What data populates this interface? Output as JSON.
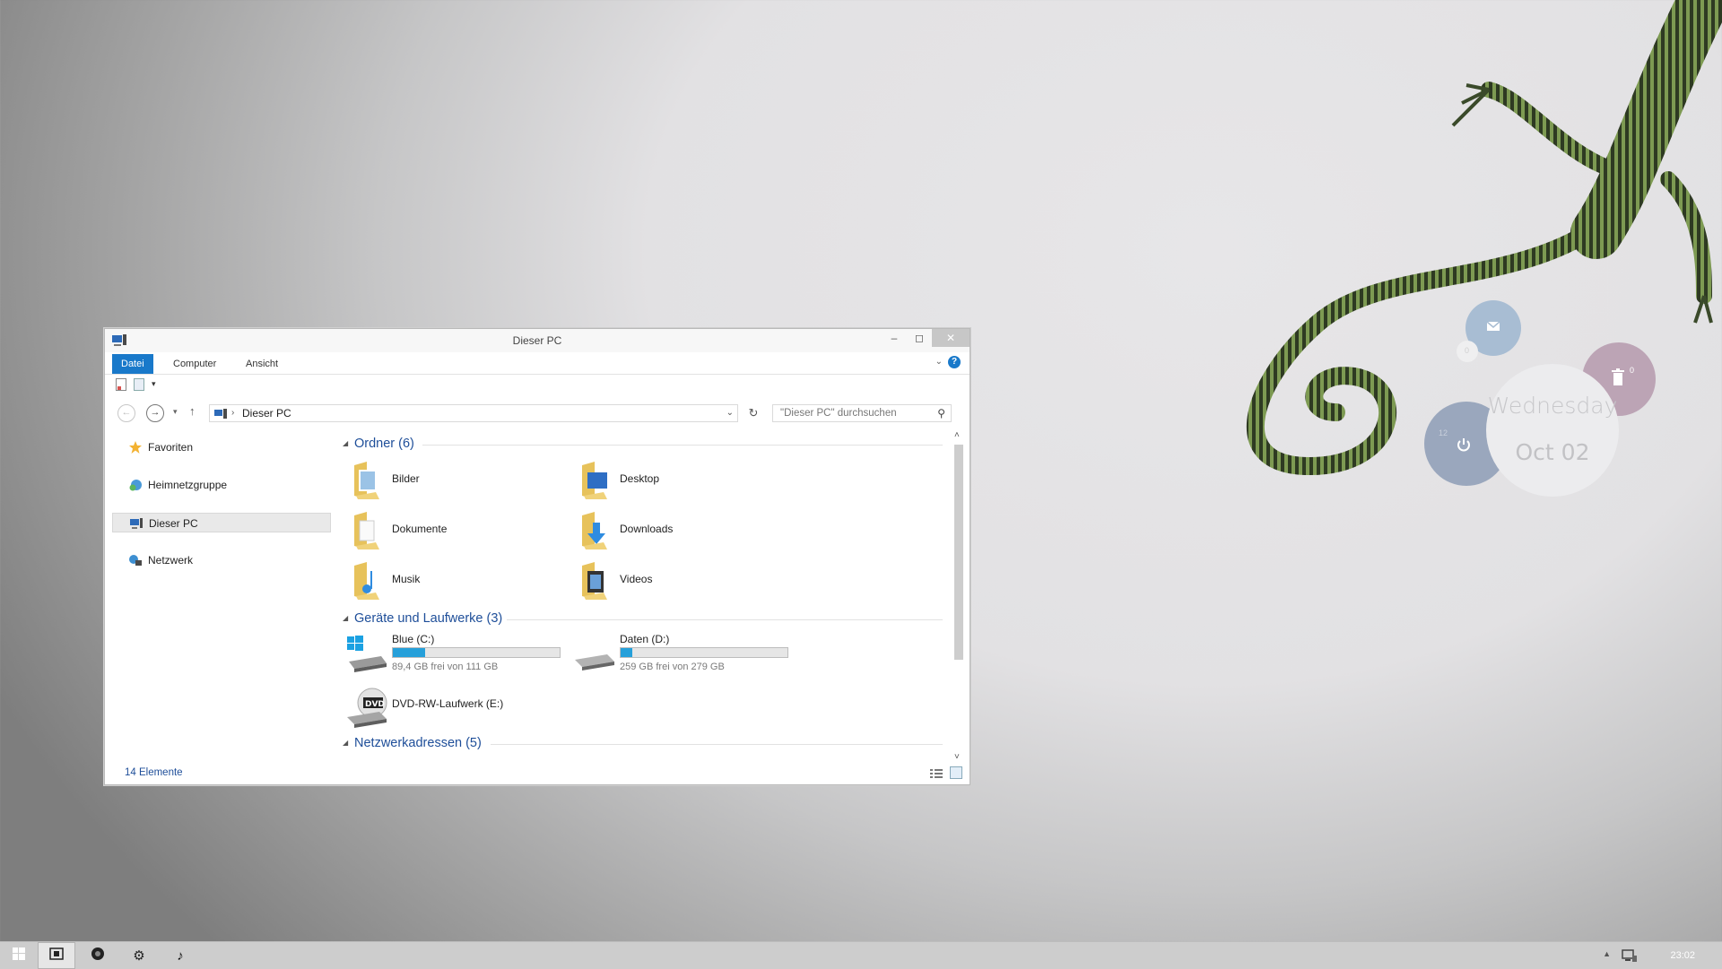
{
  "desktop": {
    "widget": {
      "day": "Wednesday",
      "date": "Oct 02",
      "mail_count": "0",
      "trash_count": "0",
      "power_small": "12"
    }
  },
  "window": {
    "title": "Dieser PC",
    "ribbon_tabs": [
      {
        "label": "Datei",
        "active": true
      },
      {
        "label": "Computer",
        "active": false
      },
      {
        "label": "Ansicht",
        "active": false
      }
    ],
    "address": "Dieser PC",
    "search_placeholder": "\"Dieser PC\" durchsuchen",
    "nav": [
      {
        "label": "Favoriten",
        "icon": "star-icon"
      },
      {
        "label": "Heimnetzgruppe",
        "icon": "homegroup-icon"
      },
      {
        "label": "Dieser PC",
        "icon": "computer-icon",
        "selected": true
      },
      {
        "label": "Netzwerk",
        "icon": "network-icon"
      }
    ],
    "groups": {
      "folders": "Ordner (6)",
      "devices": "Geräte und Laufwerke (3)",
      "network": "Netzwerkadressen (5)"
    },
    "folders": [
      {
        "label": "Bilder",
        "icon": "pictures-folder-icon"
      },
      {
        "label": "Desktop",
        "icon": "desktop-folder-icon"
      },
      {
        "label": "Dokumente",
        "icon": "documents-folder-icon"
      },
      {
        "label": "Downloads",
        "icon": "downloads-folder-icon"
      },
      {
        "label": "Musik",
        "icon": "music-folder-icon"
      },
      {
        "label": "Videos",
        "icon": "videos-folder-icon"
      }
    ],
    "drives": [
      {
        "name": "Blue (C:)",
        "free": "89,4 GB frei von 111 GB",
        "used_fraction": 0.195
      },
      {
        "name": "Daten (D:)",
        "free": "259 GB frei von 279 GB",
        "used_fraction": 0.072
      },
      {
        "name": "DVD-RW-Laufwerk (E:)"
      }
    ],
    "status": "14 Elemente"
  },
  "taskbar": {
    "clock": "23:02"
  }
}
